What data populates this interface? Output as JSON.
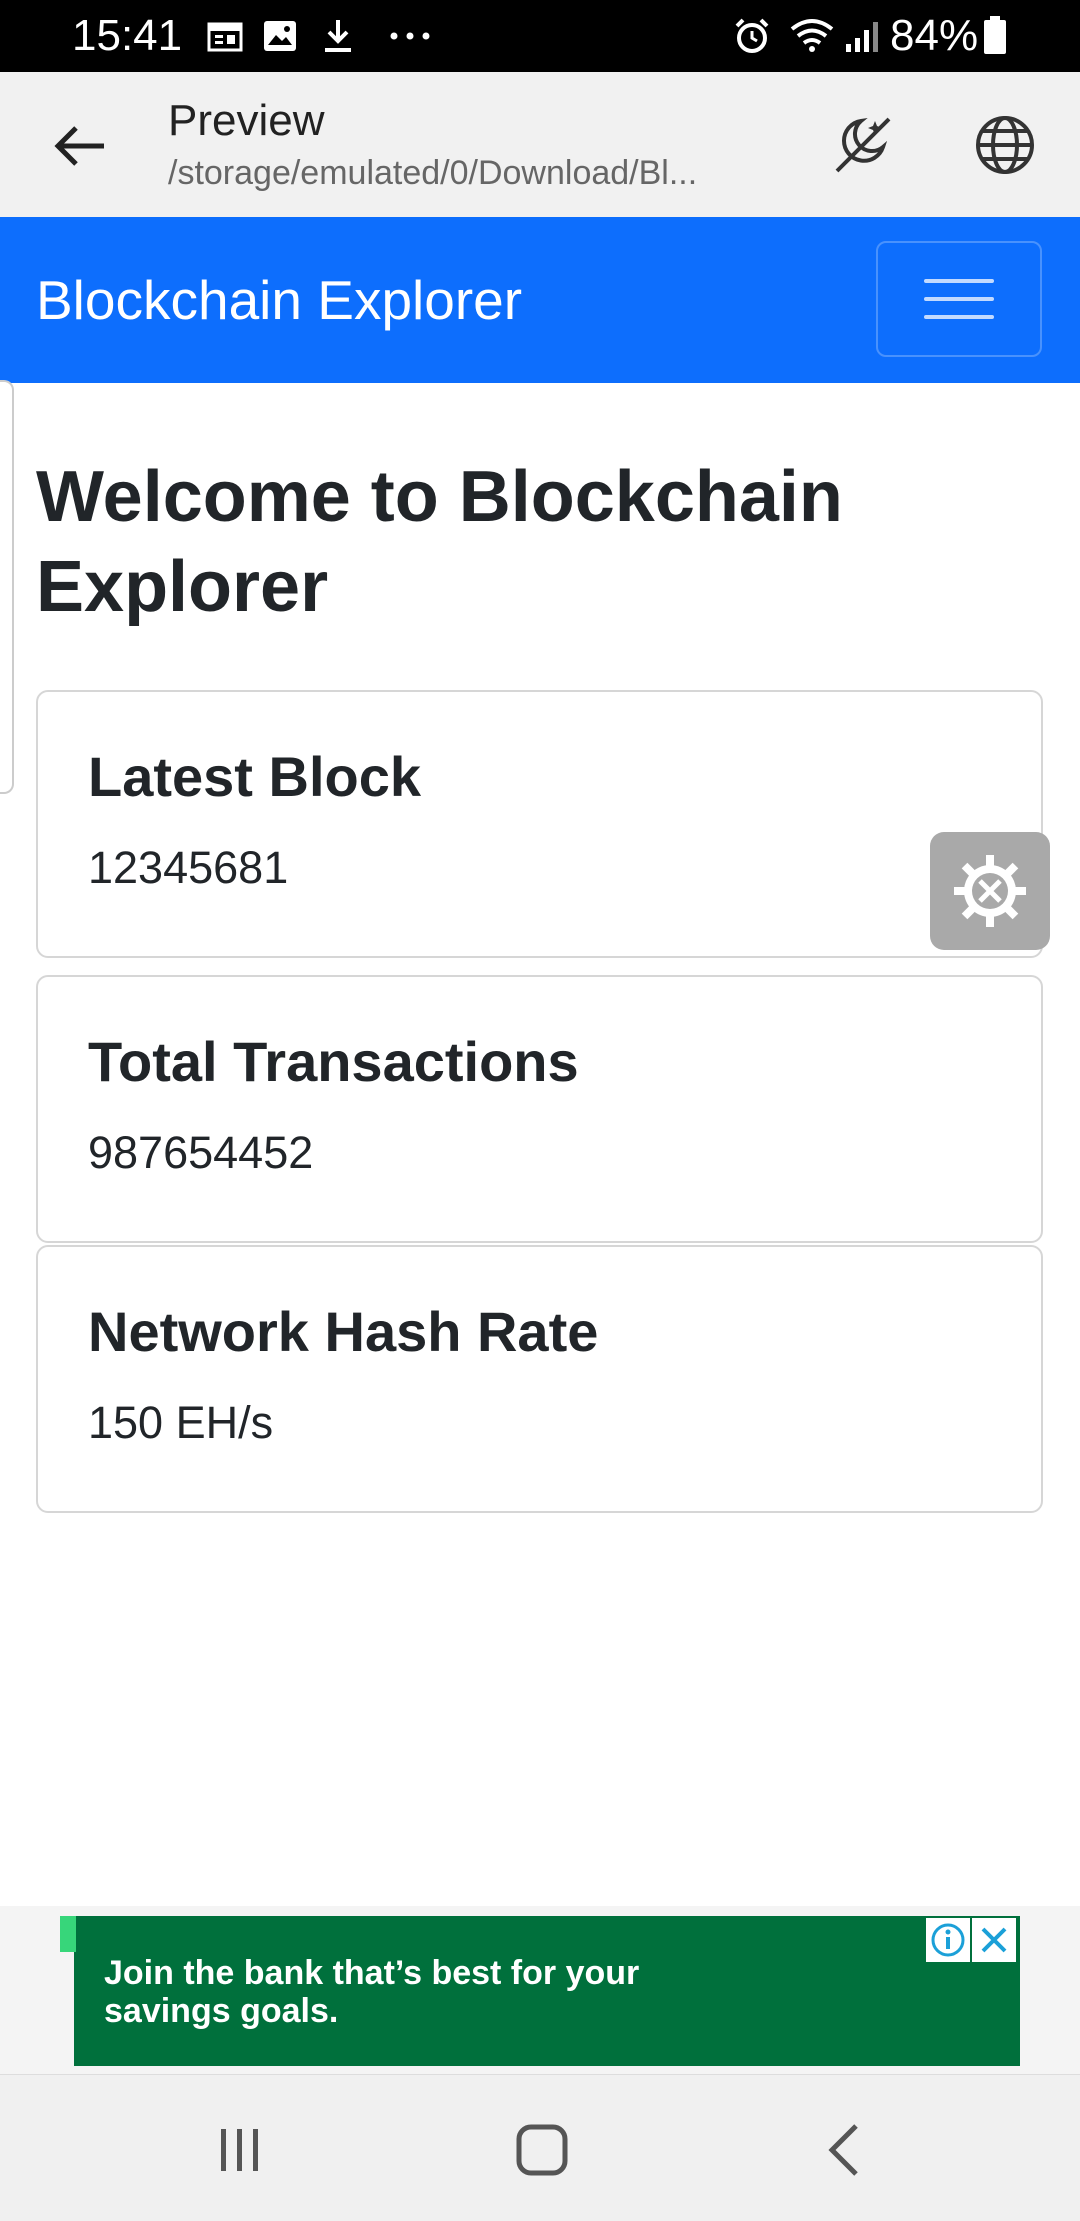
{
  "status_bar": {
    "time": "15:41",
    "battery": "84%",
    "icons": [
      "calendar-icon",
      "image-icon",
      "download-icon",
      "more-dots-icon",
      "alarm-icon",
      "wifi-icon",
      "signal-icon",
      "battery-icon"
    ]
  },
  "app_bar": {
    "title": "Preview",
    "subtitle": "/storage/emulated/0/Download/Bl...",
    "icons": [
      "back-arrow-icon",
      "night-mode-icon",
      "globe-icon"
    ]
  },
  "navbar": {
    "brand": "Blockchain Explorer",
    "accent": "#0d6efd"
  },
  "main": {
    "heading": "Welcome to Blockchain Explorer",
    "cards": [
      {
        "title": "Latest Block",
        "value": "12345681"
      },
      {
        "title": "Total Transactions",
        "value": "987654452"
      },
      {
        "title": "Network Hash Rate",
        "value": "150 EH/s"
      }
    ]
  },
  "ad": {
    "text": "Join the bank that’s best for your savings goals.",
    "background": "#00703c"
  },
  "bottom_nav": {
    "icons": [
      "recent-apps-icon",
      "home-icon",
      "back-icon"
    ]
  }
}
